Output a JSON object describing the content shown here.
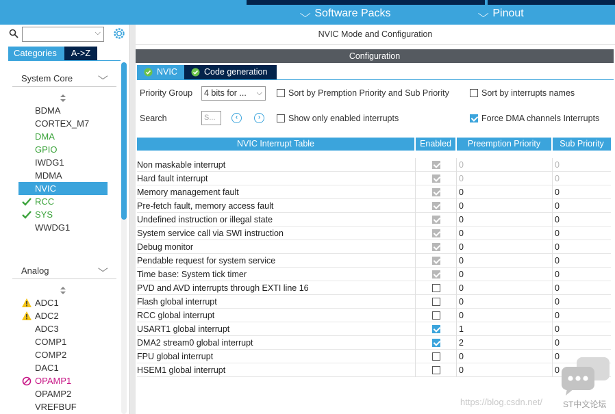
{
  "menubar": {
    "software_packs": "Software Packs",
    "pinout": "Pinout"
  },
  "left": {
    "search_placeholder": "",
    "tabs": {
      "categories": "Categories",
      "atoz": "A->Z"
    },
    "system_core": {
      "title": "System Core",
      "items": [
        {
          "label": "BDMA",
          "state": "normal"
        },
        {
          "label": "CORTEX_M7",
          "state": "normal"
        },
        {
          "label": "DMA",
          "state": "green"
        },
        {
          "label": "GPIO",
          "state": "green"
        },
        {
          "label": "IWDG1",
          "state": "normal"
        },
        {
          "label": "MDMA",
          "state": "normal"
        },
        {
          "label": "NVIC",
          "state": "selected"
        },
        {
          "label": "RCC",
          "state": "check"
        },
        {
          "label": "SYS",
          "state": "check"
        },
        {
          "label": "WWDG1",
          "state": "normal"
        }
      ]
    },
    "analog": {
      "title": "Analog",
      "items": [
        {
          "label": "ADC1",
          "state": "warn"
        },
        {
          "label": "ADC2",
          "state": "warn"
        },
        {
          "label": "ADC3",
          "state": "normal"
        },
        {
          "label": "COMP1",
          "state": "normal"
        },
        {
          "label": "COMP2",
          "state": "normal"
        },
        {
          "label": "DAC1",
          "state": "normal"
        },
        {
          "label": "OPAMP1",
          "state": "forbidden"
        },
        {
          "label": "OPAMP2",
          "state": "normal"
        },
        {
          "label": "VREFBUF",
          "state": "normal"
        }
      ]
    }
  },
  "main": {
    "title": "NVIC Mode and Configuration",
    "config_header": "Configuration",
    "tabs": {
      "nvic": "NVIC",
      "code_generation": "Code generation"
    },
    "priority_group_label": "Priority Group",
    "priority_group_value": "4 bits for ...",
    "search_label": "Search",
    "search_placeholder": "S...",
    "sort_premption": "Sort by Premption Priority and Sub Priority",
    "sort_names": "Sort by interrupts names",
    "show_enabled": "Show only enabled interrupts",
    "force_dma": "Force DMA channels Interrupts",
    "force_dma_checked": true,
    "sort_premption_checked": false,
    "sort_names_checked": false,
    "show_enabled_checked": false
  },
  "table": {
    "headers": [
      "NVIC Interrupt Table",
      "Enabled",
      "Preemption Priority",
      "Sub Priority"
    ],
    "rows": [
      {
        "name": "Non maskable interrupt",
        "enabled": "grey",
        "pp": "0",
        "sp": "0",
        "dim": true
      },
      {
        "name": "Hard fault interrupt",
        "enabled": "grey",
        "pp": "0",
        "sp": "0",
        "dim": true
      },
      {
        "name": "Memory management fault",
        "enabled": "grey",
        "pp": "0",
        "sp": "0",
        "dim": false
      },
      {
        "name": "Pre-fetch fault, memory access fault",
        "enabled": "grey",
        "pp": "0",
        "sp": "0",
        "dim": false
      },
      {
        "name": "Undefined instruction or illegal state",
        "enabled": "grey",
        "pp": "0",
        "sp": "0",
        "dim": false
      },
      {
        "name": "System service call via SWI instruction",
        "enabled": "grey",
        "pp": "0",
        "sp": "0",
        "dim": false
      },
      {
        "name": "Debug monitor",
        "enabled": "grey",
        "pp": "0",
        "sp": "0",
        "dim": false
      },
      {
        "name": "Pendable request for system service",
        "enabled": "grey",
        "pp": "0",
        "sp": "0",
        "dim": false
      },
      {
        "name": "Time base: System tick timer",
        "enabled": "grey",
        "pp": "0",
        "sp": "0",
        "dim": false
      },
      {
        "name": "PVD and AVD interrupts through EXTI line 16",
        "enabled": "off",
        "pp": "0",
        "sp": "0",
        "dim": false
      },
      {
        "name": "Flash global interrupt",
        "enabled": "off",
        "pp": "0",
        "sp": "0",
        "dim": false
      },
      {
        "name": "RCC global interrupt",
        "enabled": "off",
        "pp": "0",
        "sp": "0",
        "dim": false
      },
      {
        "name": "USART1 global interrupt",
        "enabled": "on",
        "pp": "1",
        "sp": "0",
        "dim": false
      },
      {
        "name": "DMA2 stream0 global interrupt",
        "enabled": "on",
        "pp": "2",
        "sp": "0",
        "dim": false
      },
      {
        "name": "FPU global interrupt",
        "enabled": "off",
        "pp": "0",
        "sp": "0",
        "dim": false
      },
      {
        "name": "HSEM1 global interrupt",
        "enabled": "off",
        "pp": "0",
        "sp": "0",
        "dim": false
      }
    ]
  },
  "watermark": {
    "url": "https://blog.csdn.net/",
    "brand": "ST中文论坛"
  },
  "colors": {
    "accent": "#3ba4dc",
    "dark": "#03234b",
    "green": "#3ba33b",
    "warn": "#f5c518",
    "forbidden": "#c71585"
  }
}
